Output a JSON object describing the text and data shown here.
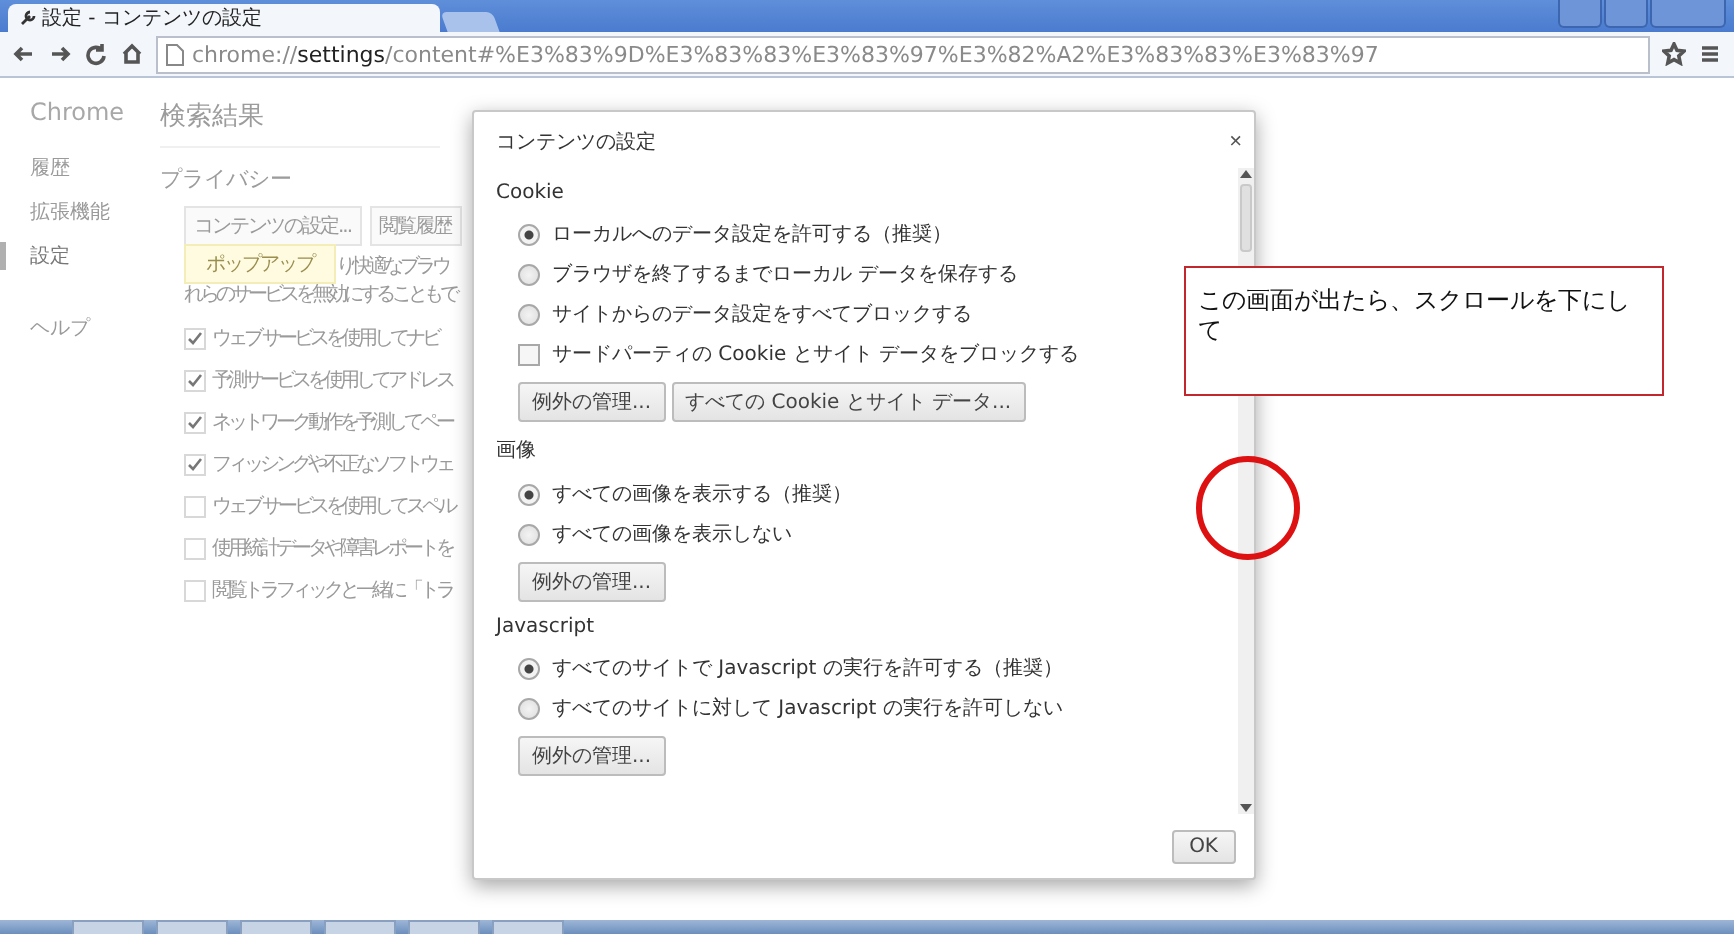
{
  "browser": {
    "tab_title": "設定 - コンテンツの設定",
    "url": "chrome://**settings**/content#%E3%83%9D%E3%83%83%E3%83%97%E3%82%A2%E3%83%83%E3%83%97"
  },
  "sidebar": {
    "title": "Chrome",
    "items": [
      {
        "label": "履歴",
        "selected": false
      },
      {
        "label": "拡張機能",
        "selected": false
      },
      {
        "label": "設定",
        "selected": true
      },
      {
        "label": "ヘルプ",
        "selected": false
      }
    ]
  },
  "page": {
    "title": "検索結果",
    "section": "プライバシー",
    "buttons": [
      "コンテンツの設定...",
      "閲覧履歴"
    ],
    "tooltip": "ポップアップ",
    "paragraph": [
      "り快適なブラウ",
      "れらのサービスを無効にすることもで"
    ],
    "options": [
      {
        "label": "ウェブ サービスを使用してナビ",
        "checked": true
      },
      {
        "label": "予測サービスを使用してアドレス",
        "checked": true
      },
      {
        "label": "ネットワーク動作を予測してペー",
        "checked": true
      },
      {
        "label": "フィッシングや不正なソフトウェ",
        "checked": true
      },
      {
        "label": "ウェブ サービスを使用してスペル",
        "checked": false
      },
      {
        "label": "使用統計データや障害レポートを",
        "checked": false
      },
      {
        "label": "閲覧トラフィックと一緒に「トラ",
        "checked": false
      }
    ]
  },
  "dialog": {
    "title": "コンテンツの設定",
    "close": "×",
    "groups": [
      {
        "heading": "Cookie",
        "options": [
          {
            "kind": "radio",
            "label": "ローカルへのデータ設定を許可する（推奨）",
            "selected": true
          },
          {
            "kind": "radio",
            "label": "ブラウザを終了するまでローカル データを保存する",
            "selected": false
          },
          {
            "kind": "radio",
            "label": "サイトからのデータ設定をすべてブロックする",
            "selected": false
          },
          {
            "kind": "checkbox",
            "label": "サードパーティの Cookie とサイト データをブロックする",
            "checked": false
          }
        ],
        "buttons": [
          "例外の管理...",
          "すべての Cookie とサイト データ..."
        ]
      },
      {
        "heading": "画像",
        "options": [
          {
            "kind": "radio",
            "label": "すべての画像を表示する（推奨）",
            "selected": true
          },
          {
            "kind": "radio",
            "label": "すべての画像を表示しない",
            "selected": false
          }
        ],
        "buttons": [
          "例外の管理..."
        ]
      },
      {
        "heading": "Javascript",
        "options": [
          {
            "kind": "radio",
            "label": "すべてのサイトで Javascript の実行を許可する（推奨）",
            "selected": true
          },
          {
            "kind": "radio",
            "label": "すべてのサイトに対して Javascript の実行を許可しない",
            "selected": false
          }
        ],
        "buttons": [
          "例外の管理..."
        ]
      }
    ],
    "ok": "OK"
  },
  "callout": {
    "text": "この画面が出たら、スクロールを下にして"
  }
}
